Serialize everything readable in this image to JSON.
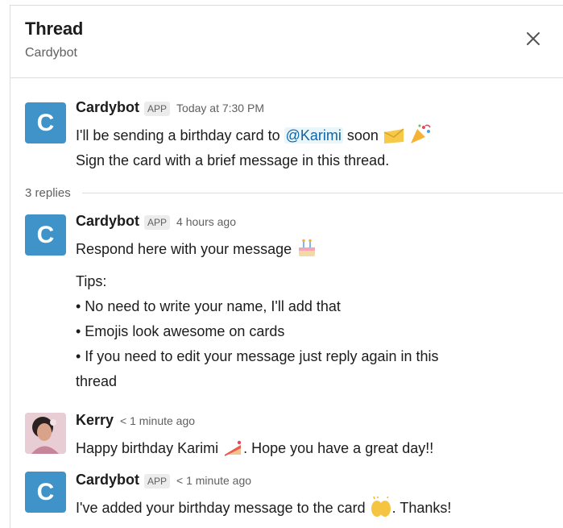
{
  "header": {
    "title": "Thread",
    "subtitle": "Cardybot"
  },
  "parent": {
    "avatar_letter": "C",
    "name": "Cardybot",
    "badge": "APP",
    "time": "Today at 7:30 PM",
    "line1_before": "I'll be sending a birthday card to",
    "mention": "@Karimi",
    "line1_after": "soon",
    "line2": "Sign the card with a brief message in this thread."
  },
  "replies_label": "3 replies",
  "messages": [
    {
      "avatar_letter": "C",
      "name": "Cardybot",
      "badge": "APP",
      "time": "4 hours ago",
      "line1": "Respond here with your message",
      "tips_heading": "Tips:",
      "tips": [
        "• No need to write your name, I'll add that",
        "• Emojis look awesome on cards",
        "• If you need to edit your message just reply again in this",
        "thread"
      ]
    },
    {
      "name": "Kerry",
      "time": "< 1 minute ago",
      "text_before": "Happy birthday Karimi",
      "text_after": ". Hope you have a great day!!"
    },
    {
      "avatar_letter": "C",
      "name": "Cardybot",
      "badge": "APP",
      "time": "< 1 minute ago",
      "text_before": "I've added your birthday message to the card",
      "text_after": ". Thanks!"
    }
  ],
  "icons": {
    "close": "close-icon",
    "envelope": "envelope-emoji",
    "party": "party-popper-emoji",
    "cake": "birthday-cake-emoji",
    "cake_slice": "cake-slice-emoji",
    "raised_hands": "raised-hands-emoji"
  },
  "colors": {
    "bot_avatar": "#3f93c9",
    "mention": "#1264a3",
    "mention_bg": "#e8f5fa"
  }
}
